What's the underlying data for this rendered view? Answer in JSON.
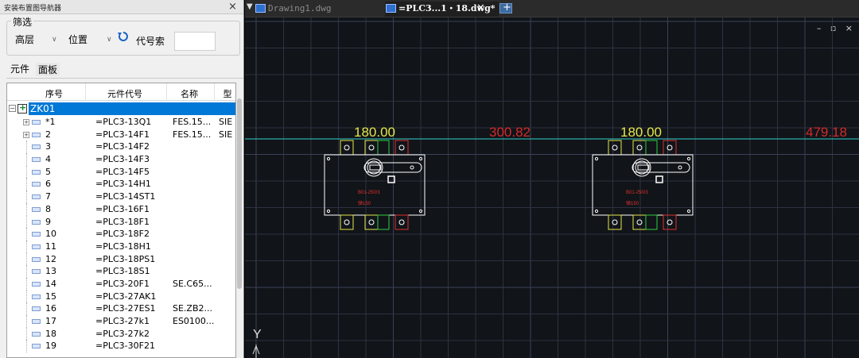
{
  "navigator": {
    "title": "安装布置图导航器",
    "close_glyph": "×",
    "filter": {
      "legend": "筛选",
      "floor_select": "高层",
      "position_select": "位置",
      "code_label": "代号索",
      "code_value": ""
    },
    "tabs": {
      "components": "元件",
      "panel": "面板"
    },
    "table": {
      "headers": {
        "seq": "序号",
        "code": "元件代号",
        "name": "名称",
        "mfr": "型"
      },
      "root": "ZK01",
      "rows": [
        {
          "seq": "*1",
          "code": "=PLC3-13Q1",
          "name": "FES.15...",
          "mfr": "SIE",
          "expandable": true
        },
        {
          "seq": "2",
          "code": "=PLC3-14F1",
          "name": "FES.15...",
          "mfr": "SIE",
          "expandable": true
        },
        {
          "seq": "3",
          "code": "=PLC3-14F2",
          "name": "",
          "mfr": ""
        },
        {
          "seq": "4",
          "code": "=PLC3-14F3",
          "name": "",
          "mfr": ""
        },
        {
          "seq": "5",
          "code": "=PLC3-14F5",
          "name": "",
          "mfr": ""
        },
        {
          "seq": "6",
          "code": "=PLC3-14H1",
          "name": "",
          "mfr": ""
        },
        {
          "seq": "7",
          "code": "=PLC3-14ST1",
          "name": "",
          "mfr": ""
        },
        {
          "seq": "8",
          "code": "=PLC3-16F1",
          "name": "",
          "mfr": ""
        },
        {
          "seq": "9",
          "code": "=PLC3-18F1",
          "name": "",
          "mfr": ""
        },
        {
          "seq": "10",
          "code": "=PLC3-18F2",
          "name": "",
          "mfr": ""
        },
        {
          "seq": "11",
          "code": "=PLC3-18H1",
          "name": "",
          "mfr": ""
        },
        {
          "seq": "12",
          "code": "=PLC3-18PS1",
          "name": "",
          "mfr": ""
        },
        {
          "seq": "13",
          "code": "=PLC3-18S1",
          "name": "",
          "mfr": ""
        },
        {
          "seq": "14",
          "code": "=PLC3-20F1",
          "name": "SE.C65...",
          "mfr": ""
        },
        {
          "seq": "15",
          "code": "=PLC3-27AK1",
          "name": "",
          "mfr": ""
        },
        {
          "seq": "16",
          "code": "=PLC3-27ES1",
          "name": "SE.ZB2...",
          "mfr": ""
        },
        {
          "seq": "17",
          "code": "=PLC3-27k1",
          "name": "ES0100...",
          "mfr": ""
        },
        {
          "seq": "18",
          "code": "=PLC3-27k2",
          "name": "",
          "mfr": ""
        },
        {
          "seq": "19",
          "code": "=PLC3-30F21",
          "name": "",
          "mfr": ""
        }
      ]
    }
  },
  "drawing": {
    "tabs": [
      {
        "label": "Drawing1.dwg",
        "active": false
      },
      {
        "label": "=PLC3...1・18.dwg*",
        "active": true,
        "close_glyph": "✕"
      }
    ],
    "menu_glyph": "▼",
    "window_controls": "– ▫ ×",
    "dimensions": [
      "180.00",
      "300.82",
      "180.00",
      "479.18"
    ],
    "component_label_1": "B01-250/3",
    "component_label_2": "弹150",
    "ucs_axis_label": "Y",
    "colors": {
      "background": "#111418",
      "grid": "#2b3242",
      "grid_major": "#39425a",
      "dimension_yellow": "#e6e64a",
      "dimension_red": "#d42a2a",
      "cyan_line": "#2fd0d0",
      "outline": "#ffffff",
      "terminal_yellow": "#e6e64a",
      "terminal_green": "#2ecc40",
      "terminal_red": "#e03030",
      "tab_active_bg": "#1f1f1f",
      "selection_blue": "#0078d7"
    }
  }
}
